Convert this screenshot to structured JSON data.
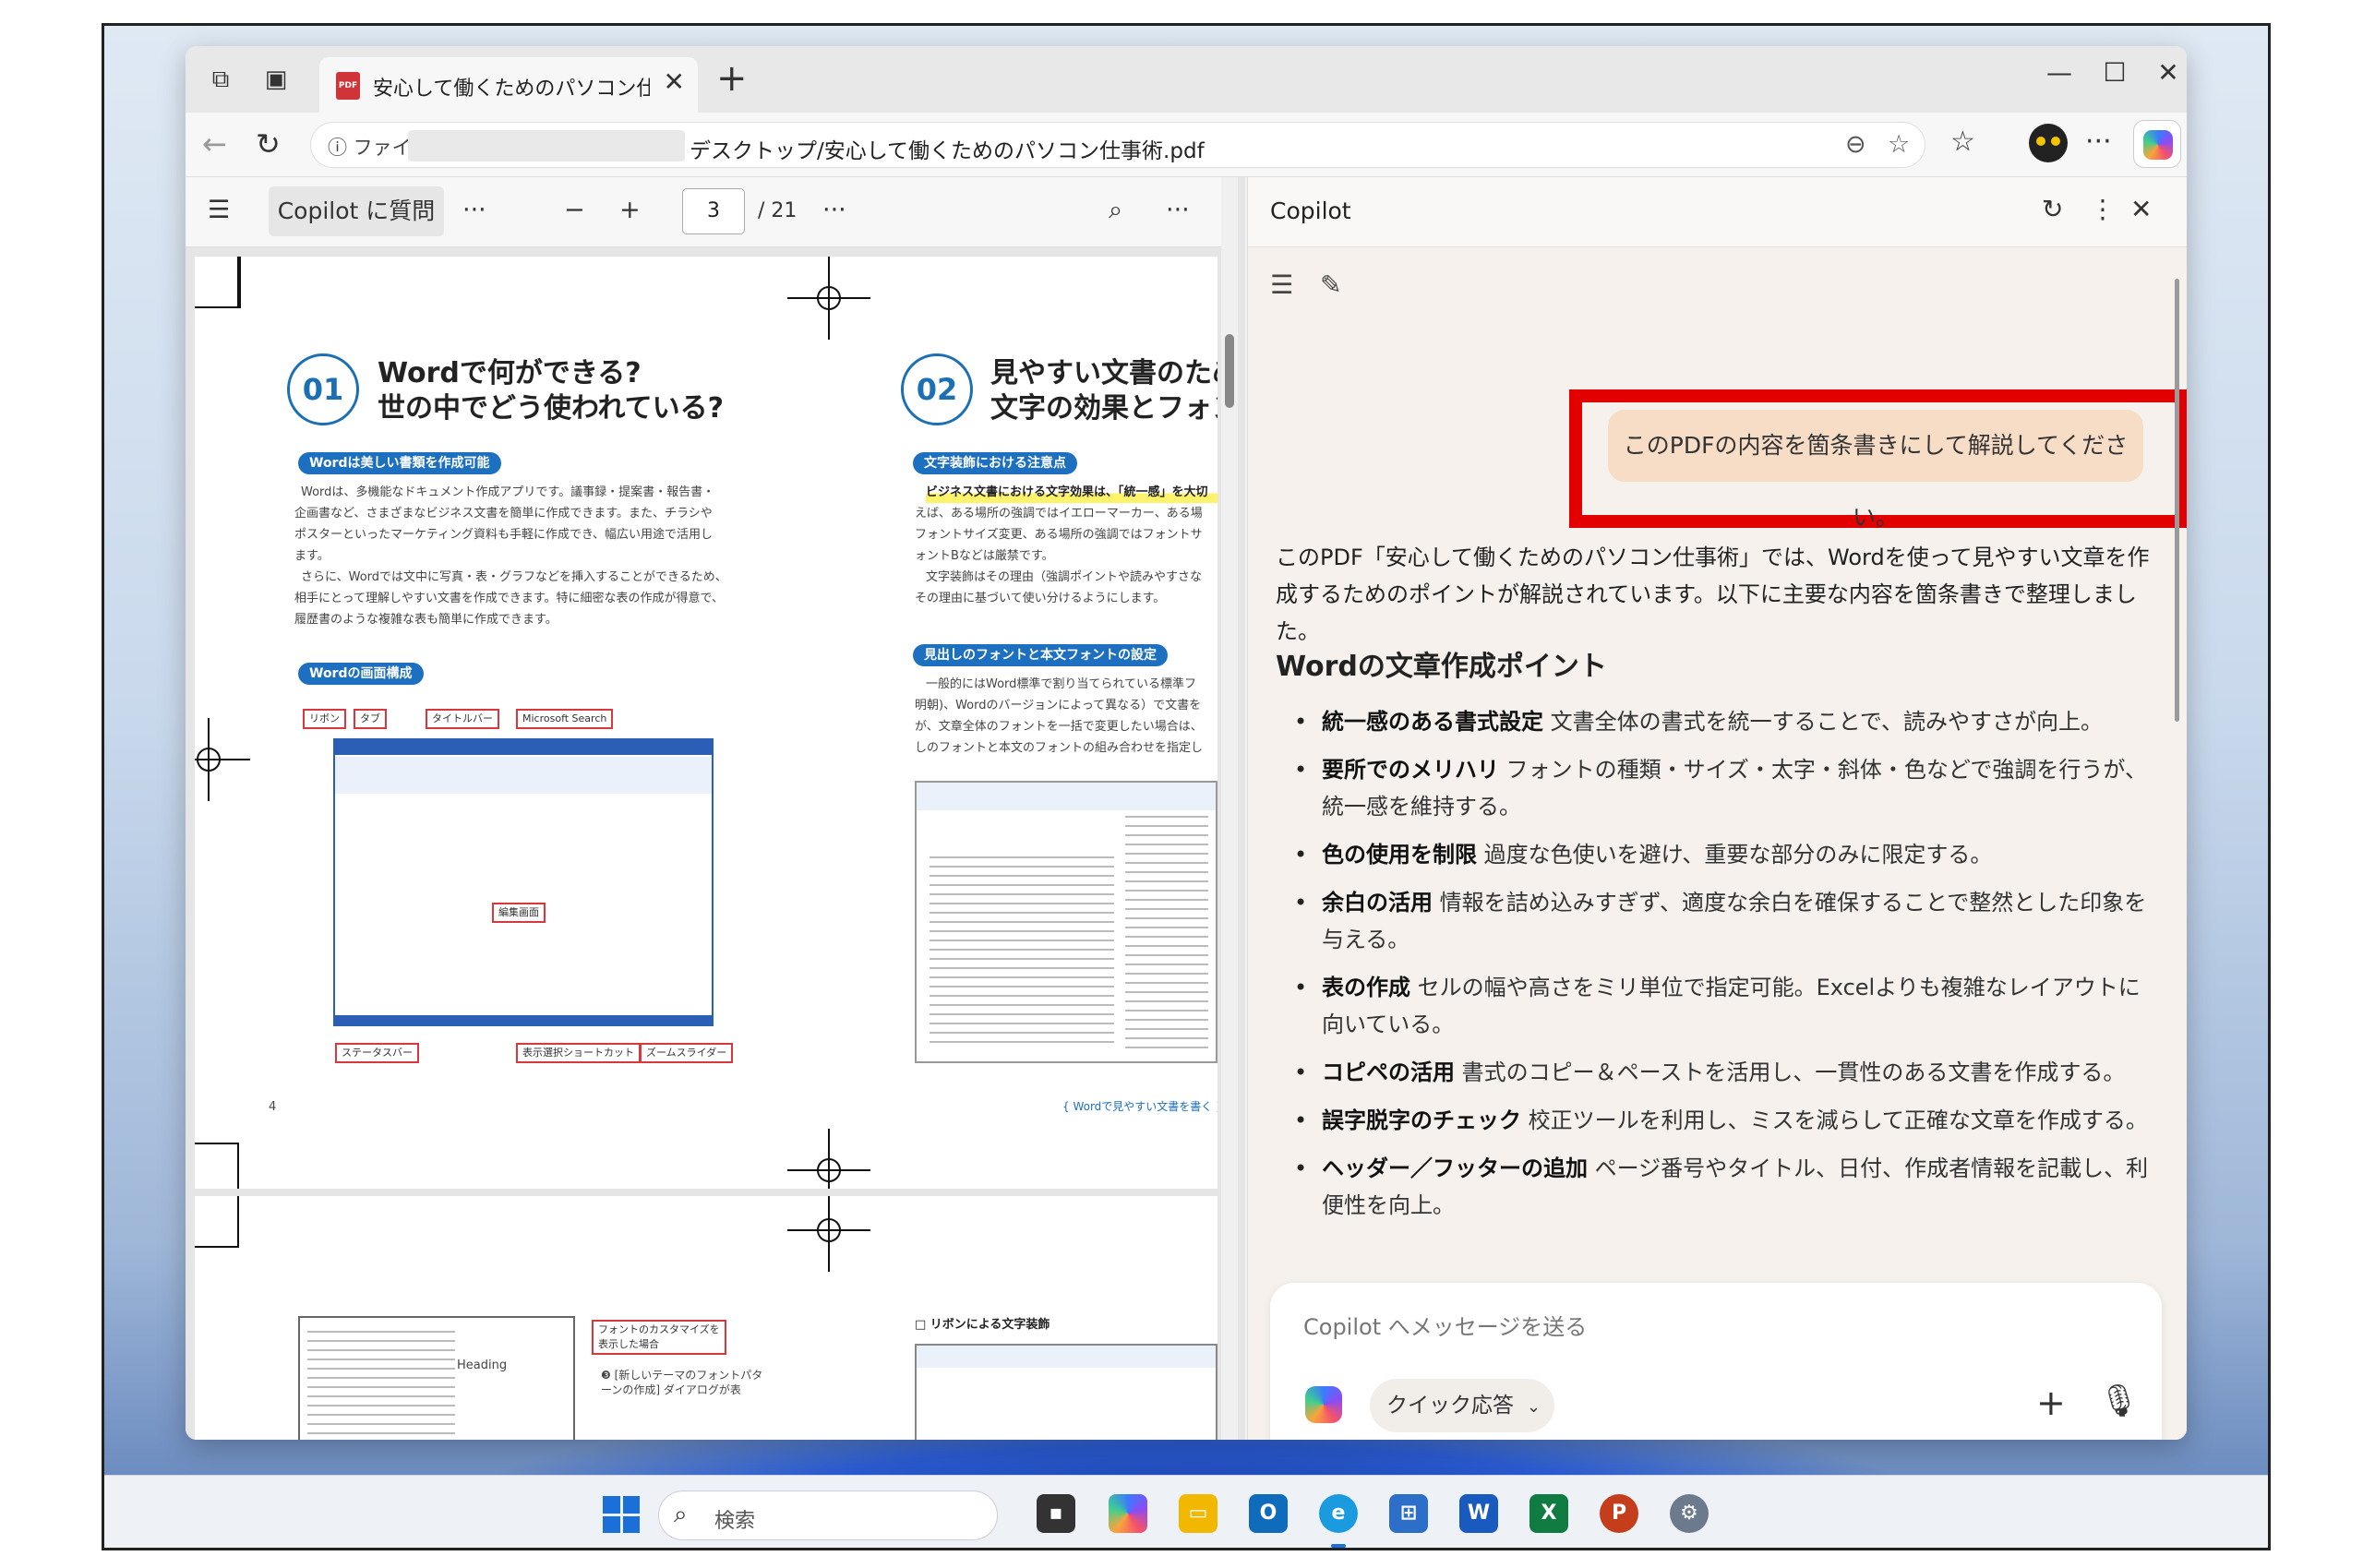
{
  "browser": {
    "tab_title": "安心して働くためのパソコン仕事術.pdf",
    "tab_close": "✕",
    "new_tab": "+",
    "address": {
      "info_label": "ⓘ ファイル",
      "url_text": "デスクトップ/安心して働くためのパソコン仕事術.pdf"
    }
  },
  "pdf_toolbar": {
    "ask_copilot": "Copilot に質問",
    "more": "···",
    "zoom_out": "−",
    "zoom_in": "+",
    "current_page": "3",
    "total_pages": "/ 21"
  },
  "pdf_page": {
    "left_section": {
      "number": "01",
      "title_line1": "Wordで何ができる?",
      "title_line2": "世の中でどう使われている?",
      "pill1": "Wordは美しい書類を作成可能",
      "para1": [
        "Wordは、多機能なドキュメント作成アプリです。議事録・提案書・報告書・",
        "企画書など、さまざまなビジネス文書を簡単に作成できます。また、チラシや",
        "ポスターといったマーケティング資料も手軽に作成でき、幅広い用途で活用し",
        "ます。",
        "さらに、Wordでは文中に写真・表・グラフなどを挿入することができるため、",
        "相手にとって理解しやすい文書を作成できます。特に細密な表の作成が得意で、",
        "履歴書のような複雑な表も簡単に作成できます。"
      ],
      "pill2": "Wordの画面構成",
      "callouts": {
        "ribbon": "リボン",
        "tab": "タブ",
        "titlebar": "タイトルバー",
        "msearch": "Microsoft Search",
        "edit_area": "編集画面",
        "statusbar": "ステータスバー",
        "view_shortcut": "表示選択ショートカット",
        "zoom_slider": "ズームスライダー"
      },
      "page_no": "4"
    },
    "right_section": {
      "number": "02",
      "title_line1": "見やすい文書のため",
      "title_line2": "文字の効果とフォン",
      "pill1": "文字装飾における注意点",
      "para1": [
        "ビジネス文書における文字効果は、「統一感」を大切",
        "えば、ある場所の強調ではイエローマーカー、ある場",
        "フォントサイズ変更、ある場所の強調ではフォントサ",
        "ォントBなどは厳禁です。",
        "文字装飾はその理由（強調ポイントや読みやすさな",
        "その理由に基づいて使い分けるようにします。"
      ],
      "pill2": "見出しのフォントと本文フォントの設定",
      "para2": [
        "一般的にはWord標準で割り当てられている標準フ",
        "明朝)、Wordのバージョンによって異なる）で文書を",
        "が、文章全体のフォントを一括で変更したい場合は、",
        "しのフォントと本文のフォントの組み合わせを指定し"
      ],
      "footer": "{ Wordで見やすい文書を書く }"
    },
    "next_page": {
      "callout1": "フォントのカスタマイズを\n表示した場合",
      "callout2": "❸ [新しいテーマのフォントパタ\nーンの作成] ダイアログが表",
      "heading_sample": "Heading",
      "ribbon_title": "□ リボンによる文字装飾"
    }
  },
  "copilot": {
    "title": "Copilot",
    "user_message": "このPDFの内容を箇条書きにして解説してください。",
    "answer_intro": "このPDF「安心して働くためのパソコン仕事術」では、Wordを使って見やすい文章を作成するためのポイントが解説されています。以下に主要な内容を箇条書きで整理しました。",
    "answer_heading": "Wordの文章作成ポイント",
    "bullets": [
      {
        "bold": "統一感のある書式設定",
        "text": " 文書全体の書式を統一することで、読みやすさが向上。"
      },
      {
        "bold": "要所でのメリハリ",
        "text": " フォントの種類・サイズ・太字・斜体・色などで強調を行うが、統一感を維持する。"
      },
      {
        "bold": "色の使用を制限",
        "text": " 過度な色使いを避け、重要な部分のみに限定する。"
      },
      {
        "bold": "余白の活用",
        "text": " 情報を詰め込みすぎず、適度な余白を確保することで整然とした印象を与える。"
      },
      {
        "bold": "表の作成",
        "text": " セルの幅や高さをミリ単位で指定可能。Excelよりも複雑なレイアウトに向いている。"
      },
      {
        "bold": "コピペの活用",
        "text": " 書式のコピー＆ペーストを活用し、一貫性のある文書を作成する。"
      },
      {
        "bold": "誤字脱字のチェック",
        "text": " 校正ツールを利用し、ミスを減らして正確な文章を作成する。"
      },
      {
        "bold": "ヘッダー／フッターの追加",
        "text": " ページ番号やタイトル、日付、作成者情報を記載し、利便性を向上。"
      }
    ],
    "composer_placeholder": "Copilot へメッセージを送る",
    "quick_reply": "クイック応答",
    "plus": "+"
  },
  "taskbar": {
    "search_label": "検索"
  },
  "colors": {
    "highlight_box": "#e30000",
    "user_bubble": "#f7dcc6",
    "accent_blue": "#1d6fc0"
  }
}
